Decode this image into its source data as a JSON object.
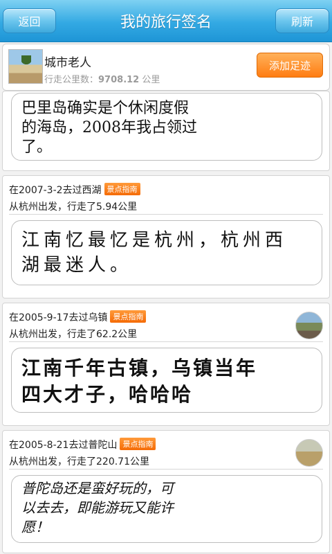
{
  "header": {
    "back_label": "返回",
    "title": "我的旅行签名",
    "refresh_label": "刷新"
  },
  "profile": {
    "name": "城市老人",
    "distance_label": "行走公里数：",
    "distance_value": "9708.12",
    "distance_unit": " 公里",
    "add_button": "添加足迹"
  },
  "cards": [
    {
      "signature": "巴里岛确实是个休闲度假\n的海岛，2008年我占领过\n了。"
    },
    {
      "line1": "在2007-3-2去过西湖",
      "tag": "景点指南",
      "line2": "从杭州出发，行走了5.94公里",
      "signature": "江南忆最忆是杭州，杭州西\n湖最迷人。"
    },
    {
      "line1": "在2005-9-17去过乌镇",
      "tag": "景点指南",
      "line2": "从杭州出发，行走了62.2公里",
      "signature": "江南千年古镇，乌镇当年\n四大才子，哈哈哈"
    },
    {
      "line1": "在2005-8-21去过普陀山",
      "tag": "景点指南",
      "line2": "从杭州出发，行走了220.71公里",
      "signature": "普陀岛还是蛮好玩的，可\n以去去，即能游玩又能许\n愿！"
    }
  ]
}
